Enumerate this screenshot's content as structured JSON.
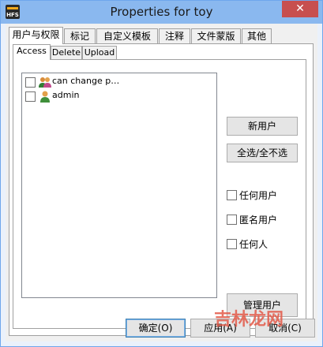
{
  "window": {
    "title": "Properties for toy",
    "app_icon_text": "HFS",
    "close_glyph": "✕"
  },
  "tabs": [
    {
      "label": "用户与权限",
      "active": true
    },
    {
      "label": "标记",
      "active": false
    },
    {
      "label": "自定义模板",
      "active": false
    },
    {
      "label": "注释",
      "active": false
    },
    {
      "label": "文件蒙版",
      "active": false
    },
    {
      "label": "其他",
      "active": false
    }
  ],
  "subtabs": [
    {
      "label": "Access",
      "active": true
    },
    {
      "label": "Delete",
      "active": false
    },
    {
      "label": "Upload",
      "active": false
    }
  ],
  "users": [
    {
      "label": "can change p…",
      "icon": "user-group-icon",
      "checked": false
    },
    {
      "label": "admin",
      "icon": "user-icon",
      "checked": false
    }
  ],
  "buttons": {
    "new_user": "新用户",
    "select_all": "全选/全不选",
    "manage_users": "管理用户",
    "ok": "确定(O)",
    "apply": "应用(A)",
    "cancel": "取消(C)"
  },
  "options": [
    {
      "label": "任何用户",
      "checked": false
    },
    {
      "label": "匿名用户",
      "checked": false
    },
    {
      "label": "任何人",
      "checked": false
    }
  ],
  "watermark": "吉林龙网",
  "colors": {
    "titlebar": "#8ab8ef",
    "close": "#c74f4f",
    "watermark": "#e35b4a"
  }
}
